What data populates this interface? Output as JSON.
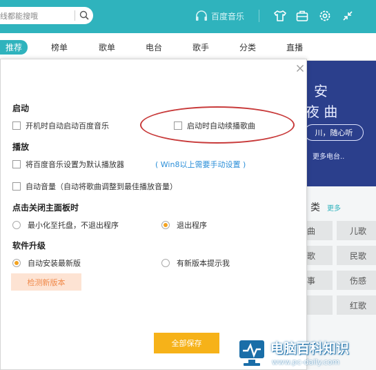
{
  "topbar": {
    "search_placeholder": "线都能搜哦",
    "brand": "百度音乐",
    "icons": [
      "search-icon",
      "shirt-icon",
      "toolbox-icon",
      "settings-icon",
      "shrink-icon"
    ]
  },
  "nav": {
    "tabs": [
      {
        "label": "推荐",
        "active": true
      },
      {
        "label": "榜单"
      },
      {
        "label": "歌单"
      },
      {
        "label": "电台"
      },
      {
        "label": "歌手"
      },
      {
        "label": "分类"
      },
      {
        "label": "直播"
      }
    ]
  },
  "background": {
    "banner_line1": "安",
    "banner_line2": "夜 曲",
    "banner_pill": "川，随心听",
    "banner_more": "更多电台..",
    "category_title": "类",
    "category_more": "更多",
    "tags": [
      "曲",
      "儿歌",
      "歌",
      "民歌",
      "事",
      "伤感",
      "",
      "红歌"
    ]
  },
  "dialog": {
    "sections": {
      "startup": "启动",
      "playback": "播放",
      "close_panel": "点击关闭主面板时",
      "upgrade": "软件升级"
    },
    "options": {
      "auto_start": "开机时自动启动百度音乐",
      "resume_play": "启动时自动续播歌曲",
      "default_player": "将百度音乐设置为默认播放器",
      "win8_note": "( Win8以上需要手动设置 )",
      "auto_volume": "自动音量（自动将歌曲调整到最佳播放音量）",
      "minimize_tray": "最小化至托盘，不退出程序",
      "exit_program": "退出程序",
      "auto_install": "自动安装最新版",
      "notify_new": "有新版本提示我"
    },
    "buttons": {
      "check_version": "检测新版本",
      "save_all": "全部保存"
    },
    "state": {
      "close_action": "exit_program",
      "upgrade_mode": "auto_install"
    }
  },
  "watermark": {
    "title": "电脑百科知识",
    "url": "www.pc-daily.com"
  },
  "colors": {
    "accent": "#2fb3bd",
    "radio_selected": "#f3a320",
    "link": "#2a8ed8",
    "save_button": "#f6b219",
    "check_button_bg": "#fde3d3",
    "highlight_ellipse": "#c83a3a"
  }
}
